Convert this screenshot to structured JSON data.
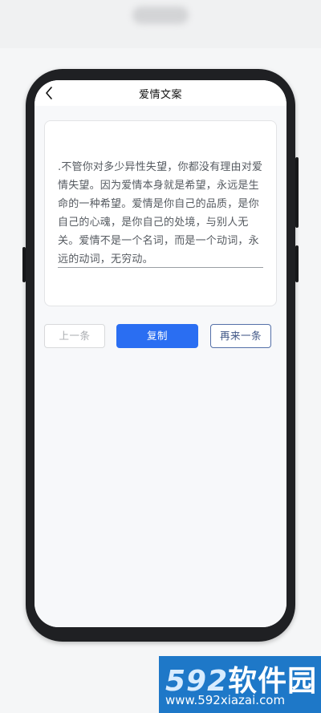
{
  "nav": {
    "title": "爱情文案"
  },
  "quote": {
    "text": ".不管你对多少异性失望，你都没有理由对爱情失望。因为爱情本身就是希望，永远是生命的一种希望。爱情是你自己的品质，是你自己的心魂，是你自己的处境，与别人无关。爱情不是一个名词，而是一个动词，永远的动词，无穷动。"
  },
  "buttons": {
    "prev": "上一条",
    "copy": "复制",
    "next": "再来一条"
  },
  "watermark": {
    "digits": "592",
    "brand": "软件园",
    "url": "www.592xiazai.com"
  },
  "colors": {
    "accent": "#2a6ef2",
    "watermark_bg": "#1e78c8"
  }
}
